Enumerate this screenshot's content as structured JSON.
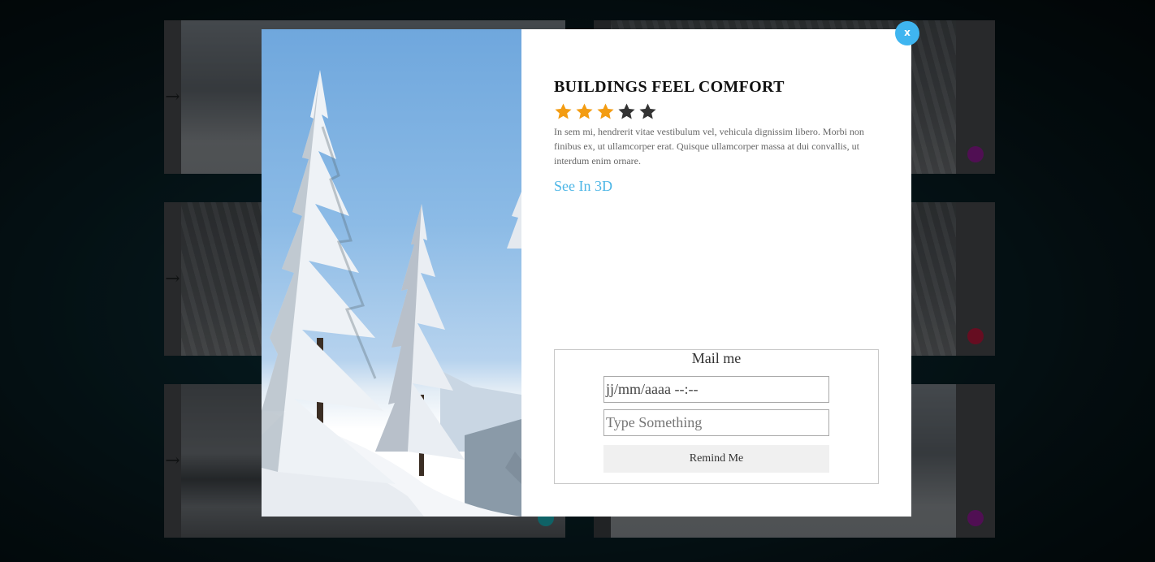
{
  "background": {
    "cards": [
      {
        "side": "left",
        "style": "snowy",
        "dot_color": ""
      },
      {
        "side": "right",
        "style": "forest",
        "dot_color": "#8a1a8f"
      },
      {
        "side": "left",
        "style": "forest",
        "dot_color": ""
      },
      {
        "side": "right",
        "style": "forest",
        "dot_color": "#b0183a"
      },
      {
        "side": "left",
        "style": "lake",
        "dot_color": "#1aa9b0"
      },
      {
        "side": "right",
        "style": "snowy",
        "dot_color": "#8a1a8f"
      }
    ],
    "arrow_glyph": "→"
  },
  "modal": {
    "title": "BUILDINGS FEEL COMFORT",
    "rating": {
      "value": 3,
      "max": 5,
      "filled_color": "#f39c12",
      "empty_color": "#333333"
    },
    "description": "In sem mi, hendrerit vitae vestibulum vel, vehicula dignissim libero. Morbi non finibus ex, ut ullamcorper erat. Quisque ullamcorper massa at dui convallis, ut interdum enim ornare.",
    "link_label": "See In 3D",
    "link_color": "#4db6e6",
    "mail_form": {
      "title": "Mail me",
      "datetime_value": "jj/mm/aaaa --:--",
      "message_placeholder": "Type Something",
      "button_label": "Remind Me"
    },
    "close_label": "x"
  }
}
